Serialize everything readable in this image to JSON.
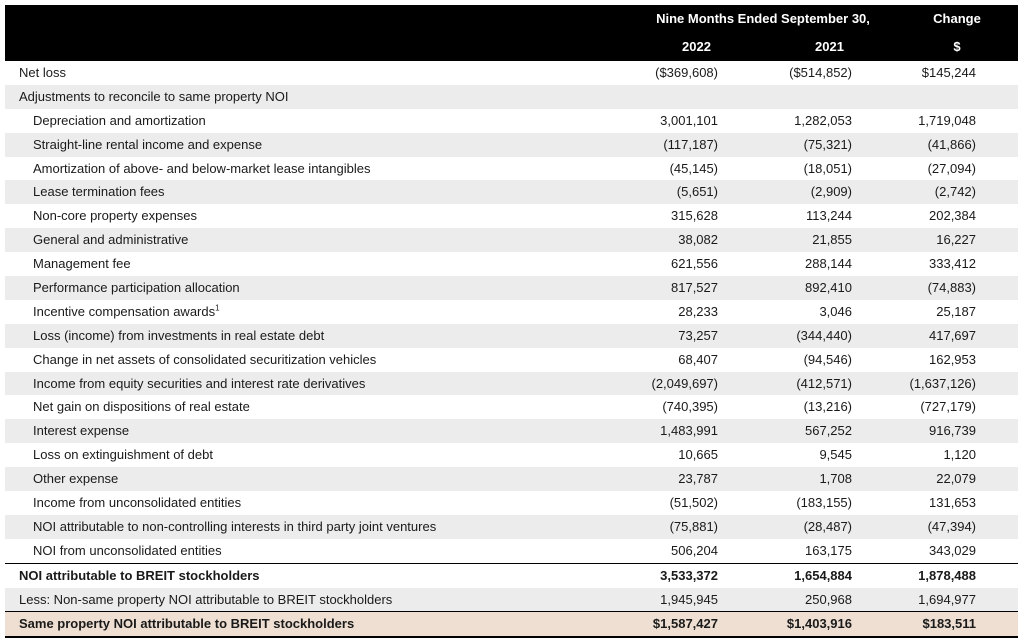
{
  "header": {
    "period_label": "Nine Months Ended September 30,",
    "change_label": "Change",
    "year1": "2022",
    "year2": "2021",
    "currency": "$"
  },
  "rows": [
    {
      "label": "Net loss",
      "v2022": "($369,608)",
      "v2021": "($514,852)",
      "change": "$145,244",
      "indent": false,
      "shade": false,
      "style": "normal"
    },
    {
      "label": "Adjustments to reconcile to same property NOI",
      "v2022": "",
      "v2021": "",
      "change": "",
      "indent": false,
      "shade": true,
      "style": "normal"
    },
    {
      "label": "Depreciation and amortization",
      "v2022": "3,001,101",
      "v2021": "1,282,053",
      "change": "1,719,048",
      "indent": true,
      "shade": false,
      "style": "normal"
    },
    {
      "label": "Straight-line rental income and expense",
      "v2022": "(117,187)",
      "v2021": "(75,321)",
      "change": "(41,866)",
      "indent": true,
      "shade": true,
      "style": "normal"
    },
    {
      "label": "Amortization of above- and below-market lease intangibles",
      "v2022": "(45,145)",
      "v2021": "(18,051)",
      "change": "(27,094)",
      "indent": true,
      "shade": false,
      "style": "normal"
    },
    {
      "label": "Lease termination fees",
      "v2022": "(5,651)",
      "v2021": "(2,909)",
      "change": "(2,742)",
      "indent": true,
      "shade": true,
      "style": "normal"
    },
    {
      "label": "Non-core property expenses",
      "v2022": "315,628",
      "v2021": "113,244",
      "change": "202,384",
      "indent": true,
      "shade": false,
      "style": "normal"
    },
    {
      "label": "General and administrative",
      "v2022": "38,082",
      "v2021": "21,855",
      "change": "16,227",
      "indent": true,
      "shade": true,
      "style": "normal"
    },
    {
      "label": "Management fee",
      "v2022": "621,556",
      "v2021": "288,144",
      "change": "333,412",
      "indent": true,
      "shade": false,
      "style": "normal"
    },
    {
      "label": "Performance participation allocation",
      "v2022": "817,527",
      "v2021": "892,410",
      "change": "(74,883)",
      "indent": true,
      "shade": true,
      "style": "normal"
    },
    {
      "label": "Incentive compensation awards",
      "footnote": "1",
      "v2022": "28,233",
      "v2021": "3,046",
      "change": "25,187",
      "indent": true,
      "shade": false,
      "style": "normal"
    },
    {
      "label": "Loss (income) from investments in real estate debt",
      "v2022": "73,257",
      "v2021": "(344,440)",
      "change": "417,697",
      "indent": true,
      "shade": true,
      "style": "normal"
    },
    {
      "label": "Change in net assets of consolidated securitization vehicles",
      "v2022": "68,407",
      "v2021": "(94,546)",
      "change": "162,953",
      "indent": true,
      "shade": false,
      "style": "normal"
    },
    {
      "label": "Income from equity securities and interest rate derivatives",
      "v2022": "(2,049,697)",
      "v2021": "(412,571)",
      "change": "(1,637,126)",
      "indent": true,
      "shade": true,
      "style": "normal"
    },
    {
      "label": "Net gain on dispositions of real estate",
      "v2022": "(740,395)",
      "v2021": "(13,216)",
      "change": "(727,179)",
      "indent": true,
      "shade": false,
      "style": "normal"
    },
    {
      "label": "Interest expense",
      "v2022": "1,483,991",
      "v2021": "567,252",
      "change": "916,739",
      "indent": true,
      "shade": true,
      "style": "normal"
    },
    {
      "label": "Loss on extinguishment of debt",
      "v2022": "10,665",
      "v2021": "9,545",
      "change": "1,120",
      "indent": true,
      "shade": false,
      "style": "normal"
    },
    {
      "label": "Other expense",
      "v2022": "23,787",
      "v2021": "1,708",
      "change": "22,079",
      "indent": true,
      "shade": true,
      "style": "normal"
    },
    {
      "label": "Income from unconsolidated entities",
      "v2022": "(51,502)",
      "v2021": "(183,155)",
      "change": "131,653",
      "indent": true,
      "shade": false,
      "style": "normal"
    },
    {
      "label": "NOI attributable to non-controlling interests in third party joint ventures",
      "v2022": "(75,881)",
      "v2021": "(28,487)",
      "change": "(47,394)",
      "indent": true,
      "shade": true,
      "style": "normal"
    },
    {
      "label": "NOI from unconsolidated entities",
      "v2022": "506,204",
      "v2021": "163,175",
      "change": "343,029",
      "indent": true,
      "shade": false,
      "style": "normal"
    },
    {
      "label": "NOI attributable to BREIT stockholders",
      "v2022": "3,533,372",
      "v2021": "1,654,884",
      "change": "1,878,488",
      "indent": false,
      "shade": false,
      "style": "total"
    },
    {
      "label": "Less: Non-same property NOI attributable to BREIT stockholders",
      "v2022": "1,945,945",
      "v2021": "250,968",
      "change": "1,694,977",
      "indent": false,
      "shade": true,
      "style": "normal"
    },
    {
      "label": "Same property NOI attributable to BREIT stockholders",
      "v2022": "$1,587,427",
      "v2021": "$1,403,916",
      "change": "$183,511",
      "indent": false,
      "shade": false,
      "style": "final"
    }
  ]
}
